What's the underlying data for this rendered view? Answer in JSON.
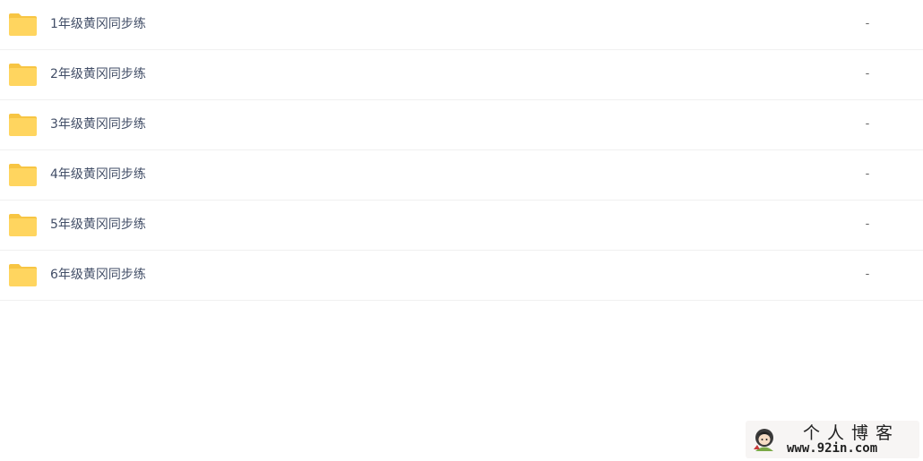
{
  "files": [
    {
      "name": "1年级黄冈同步练",
      "size": "-",
      "icon": "folder-icon"
    },
    {
      "name": "2年级黄冈同步练",
      "size": "-",
      "icon": "folder-icon"
    },
    {
      "name": "3年级黄冈同步练",
      "size": "-",
      "icon": "folder-icon"
    },
    {
      "name": "4年级黄冈同步练",
      "size": "-",
      "icon": "folder-icon"
    },
    {
      "name": "5年级黄冈同步练",
      "size": "-",
      "icon": "folder-icon"
    },
    {
      "name": "6年级黄冈同步练",
      "size": "-",
      "icon": "folder-icon"
    }
  ],
  "watermark": {
    "title": "个人博客",
    "url": "www.92in.com"
  },
  "colors": {
    "folder_body": "#ffd55f",
    "folder_tab": "#f7c543",
    "row_divider": "#f0f0f0",
    "name_text": "#424e67"
  }
}
